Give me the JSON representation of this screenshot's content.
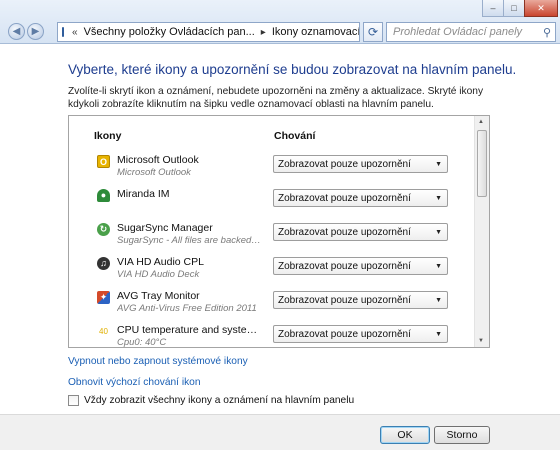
{
  "window": {
    "breadcrumb": [
      "Všechny položky Ovládacích pan...",
      "Ikony oznamovací oblasti"
    ],
    "search_placeholder": "Prohledat Ovládací panely",
    "nav_back_icon": "back-arrow-icon",
    "nav_forward_icon": "forward-arrow-icon",
    "refresh_icon": "refresh-icon",
    "search_icon": "search-icon"
  },
  "main": {
    "heading": "Vyberte, které ikony a upozornění se budou zobrazovat na hlavním panelu.",
    "description": "Zvolíte-li skrytí ikon a oznámení, nebudete upozorněni na změny a aktualizace. Skryté ikony kdykoli zobrazíte kliknutím na šipku vedle oznamovací oblasti na hlavním panelu.",
    "columns": {
      "icons": "Ikony",
      "behavior": "Chování"
    },
    "apps": [
      {
        "name": "Microsoft Outlook",
        "sub": "Microsoft Outlook",
        "behavior": "Zobrazovat pouze upozornění",
        "icon": "outlook-icon",
        "color": "#e8b400"
      },
      {
        "name": "Miranda IM",
        "sub": "",
        "behavior": "Zobrazovat pouze upozornění",
        "icon": "miranda-user-icon",
        "color": "#2e8b3a"
      },
      {
        "name": "SugarSync Manager",
        "sub": "SugarSync - All files are backed up a...",
        "behavior": "Zobrazovat pouze upozornění",
        "icon": "sugarsync-icon",
        "color": "#4aa04a"
      },
      {
        "name": "VIA HD Audio CPL",
        "sub": "VIA HD Audio Deck",
        "behavior": "Zobrazovat pouze upozornění",
        "icon": "audio-icon",
        "color": "#333333"
      },
      {
        "name": "AVG Tray Monitor",
        "sub": "AVG Anti-Virus Free Edition 2011",
        "behavior": "Zobrazovat pouze upozornění",
        "icon": "avg-icon",
        "color": "#d44a2a"
      },
      {
        "name": "CPU temperature and system inform...",
        "sub": "Cpu0: 40°C",
        "behavior": "Zobrazovat pouze upozornění",
        "icon": "cpu-temp-icon",
        "icon_text": "40",
        "color": "#e0b000"
      }
    ],
    "link_system_icons": "Vypnout nebo zapnout systémové ikony",
    "link_restore": "Obnovit výchozí chování ikon",
    "checkbox_label": "Vždy zobrazit všechny ikony a oznámení na hlavním panelu",
    "checkbox_checked": false
  },
  "footer": {
    "ok": "OK",
    "cancel": "Storno"
  }
}
